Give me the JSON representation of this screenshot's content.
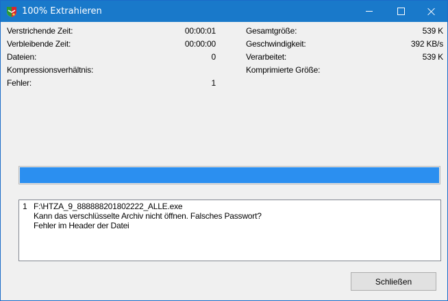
{
  "window": {
    "title": "100% Extrahieren",
    "icon": "nrw-coat-of-arms-icon",
    "controls": {
      "minimize": "minimize-icon",
      "maximize": "maximize-icon",
      "close": "close-icon"
    }
  },
  "stats": {
    "elapsed_label": "Verstrichende Zeit:",
    "elapsed_value": "00:00:01",
    "remaining_label": "Verbleibende Zeit:",
    "remaining_value": "00:00:00",
    "files_label": "Dateien:",
    "files_value": "0",
    "ratio_label": "Kompressionsverhältnis:",
    "errors_label": "Fehler:",
    "errors_value": "1",
    "total_label": "Gesamtgröße:",
    "total_value": "539 K",
    "speed_label": "Geschwindigkeit:",
    "speed_value": "392 KB/s",
    "processed_label": "Verarbeitet:",
    "processed_value": "539 K",
    "compressed_label": "Komprimierte Größe:"
  },
  "progress": {
    "percent": 100,
    "fill_color": "#2b8ff0"
  },
  "log": {
    "entries": [
      {
        "number": "1",
        "path": "F:\\HTZA_9_888888201802222_ALLE.exe",
        "message": "Kann das verschlüsselte Archiv nicht öffnen. Falsches Passwort?",
        "detail": "Fehler im Header der Datei"
      }
    ]
  },
  "buttons": {
    "close_label": "Schließen"
  },
  "colors": {
    "titlebar": "#1979ca",
    "progress": "#2b8ff0",
    "dialog_bg": "#f0f0f0"
  }
}
